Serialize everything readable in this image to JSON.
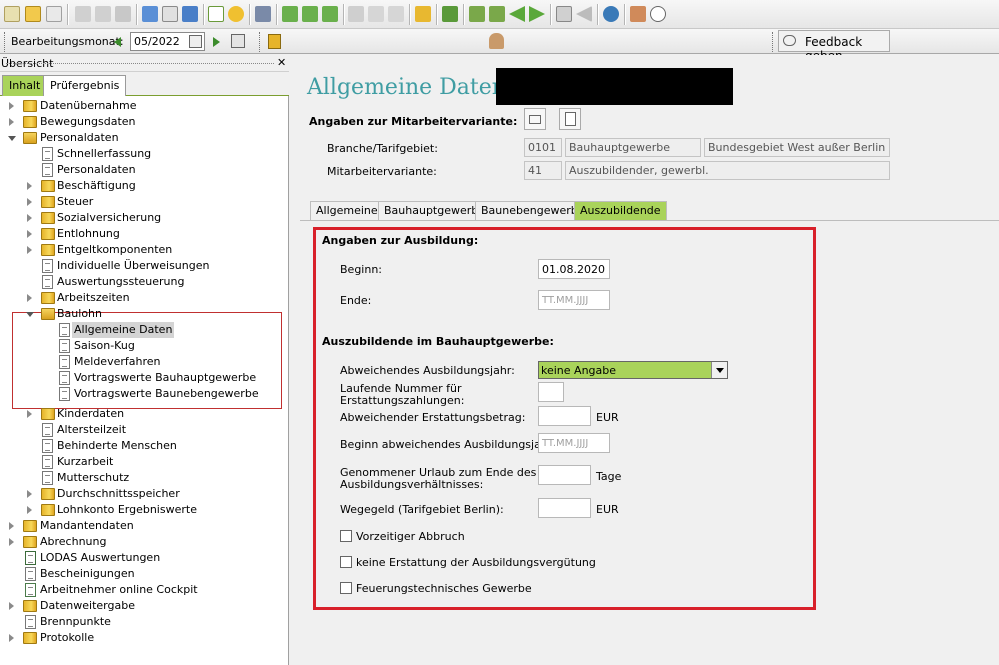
{
  "toolbar2": {
    "month_label": "Bearbeitungsmonat:",
    "month_value": "05/2022",
    "feedback_label": "Feedback geben"
  },
  "left": {
    "panel_title": "Übersicht",
    "close": "✕",
    "tabs": [
      "Inhalt",
      "Prüfergebnis"
    ],
    "tree": [
      {
        "label": "Datenübernahme"
      },
      {
        "label": "Bewegungsdaten"
      },
      {
        "label": "Personaldaten"
      },
      {
        "label": "Schnellerfassung"
      },
      {
        "label": "Personaldaten"
      },
      {
        "label": "Beschäftigung"
      },
      {
        "label": "Steuer"
      },
      {
        "label": "Sozialversicherung"
      },
      {
        "label": "Entlohnung"
      },
      {
        "label": "Entgeltkomponenten"
      },
      {
        "label": "Individuelle Überweisungen"
      },
      {
        "label": "Auswertungssteuerung"
      },
      {
        "label": "Arbeitszeiten"
      },
      {
        "label": "Baulohn"
      },
      {
        "label": "Allgemeine Daten"
      },
      {
        "label": "Saison-Kug"
      },
      {
        "label": "Meldeverfahren"
      },
      {
        "label": "Vortragswerte Bauhauptgewerbe"
      },
      {
        "label": "Vortragswerte Baunebengewerbe"
      },
      {
        "label": "Kinderdaten"
      },
      {
        "label": "Altersteilzeit"
      },
      {
        "label": "Behinderte Menschen"
      },
      {
        "label": "Kurzarbeit"
      },
      {
        "label": "Mutterschutz"
      },
      {
        "label": "Durchschnittsspeicher"
      },
      {
        "label": "Lohnkonto Ergebniswerte"
      },
      {
        "label": "Mandantendaten"
      },
      {
        "label": "Abrechnung"
      },
      {
        "label": "LODAS Auswertungen"
      },
      {
        "label": "Bescheinigungen"
      },
      {
        "label": "Arbeitnehmer online Cockpit"
      },
      {
        "label": "Datenweitergabe"
      },
      {
        "label": "Brennpunkte"
      },
      {
        "label": "Protokolle"
      }
    ]
  },
  "main": {
    "title": "Allgemeine Daten -",
    "variant_heading": "Angaben zur Mitarbeitervariante:",
    "branche_label": "Branche/Tarifgebiet:",
    "branche_code": "0101",
    "branche_name": "Bauhauptgewerbe",
    "tarifgebiet": "Bundesgebiet West außer Berlin",
    "variante_label": "Mitarbeitervariante:",
    "variante_code": "41",
    "variante_name": "Auszubildender, gewerbl.",
    "tabs": [
      "Allgemeines",
      "Bauhauptgewerbe",
      "Baunebengewerbe",
      "Auszubildende"
    ],
    "ausbildung_heading": "Angaben zur Ausbildung:",
    "beginn_label": "Beginn:",
    "beginn_value": "01.08.2020",
    "ende_label": "Ende:",
    "ende_placeholder": "TT.MM.JJJJ",
    "bauhaupt_heading": "Auszubildende im Bauhauptgewerbe:",
    "abw_jahr_label": "Abweichendes Ausbildungsjahr:",
    "abw_jahr_value": "keine Angabe",
    "lfd_nr_label_1": "Laufende Nummer für",
    "lfd_nr_label_2": "Erstattungszahlungen:",
    "abw_betrag_label": "Abweichender Erstattungsbetrag:",
    "eur": "EUR",
    "beginn_abw_label": "Beginn abweichendes Ausbildungsjahr:",
    "beginn_abw_placeholder": "TT.MM.JJJJ",
    "urlaub_label_1": "Genommener Urlaub zum Ende des",
    "urlaub_label_2": "Ausbildungsverhältnisses:",
    "tage": "Tage",
    "wegegeld_label": "Wegegeld (Tarifgebiet Berlin):",
    "checkboxes": [
      "Vorzeitiger Abbruch",
      "keine Erstattung der Ausbildungsvergütung",
      "Feuerungstechnisches Gewerbe"
    ]
  },
  "colors": {
    "accent_green": "#a9d35a",
    "title_teal": "#3f9da3",
    "highlight_red": "#d8202a"
  }
}
